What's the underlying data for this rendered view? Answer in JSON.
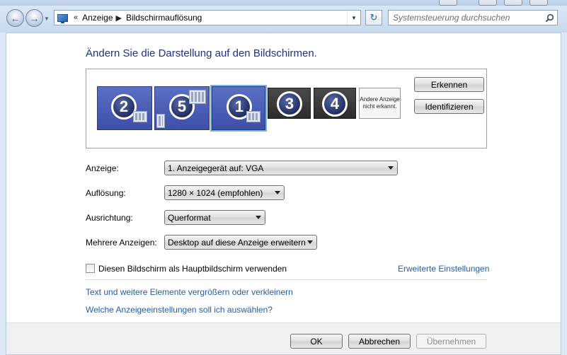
{
  "address_bar": {
    "breadcrumb": [
      "Anzeige",
      "Bildschirmauflösung"
    ],
    "search_placeholder": "Systemsteuerung durchsuchen"
  },
  "page": {
    "title": "Ändern Sie die Darstellung auf den Bildschirmen."
  },
  "arrangement": {
    "monitors": [
      {
        "number": "2",
        "state": "active"
      },
      {
        "number": "5",
        "state": "active"
      },
      {
        "number": "1",
        "state": "active-selected"
      },
      {
        "number": "3",
        "state": "inactive"
      },
      {
        "number": "4",
        "state": "inactive"
      }
    ],
    "other_display_label": "Andere Anzeige nicht erkannt.",
    "detect_button": "Erkennen",
    "identify_button": "Identifizieren"
  },
  "form": {
    "display_label": "Anzeige:",
    "display_value": "1. Anzeigegerät auf: VGA",
    "resolution_label": "Auflösung:",
    "resolution_value": "1280 × 1024 (empfohlen)",
    "orientation_label": "Ausrichtung:",
    "orientation_value": "Querformat",
    "multi_label": "Mehrere Anzeigen:",
    "multi_value": "Desktop auf diese Anzeige erweitern"
  },
  "primary_checkbox": {
    "label": "Diesen Bildschirm als Hauptbildschirm verwenden",
    "checked": false
  },
  "links": {
    "advanced": "Erweiterte Einstellungen",
    "text_size": "Text und weitere Elemente vergrößern oder verkleinern",
    "which_settings": "Welche Anzeigeeinstellungen soll ich auswählen?"
  },
  "buttons": {
    "ok": "OK",
    "cancel": "Abbrechen",
    "apply": "Übernehmen"
  },
  "colors": {
    "title_blue": "#1e3287",
    "link_blue": "#1f5eae",
    "active_monitor": "#3d4fa8",
    "inactive_monitor": "#2c2c2c"
  }
}
